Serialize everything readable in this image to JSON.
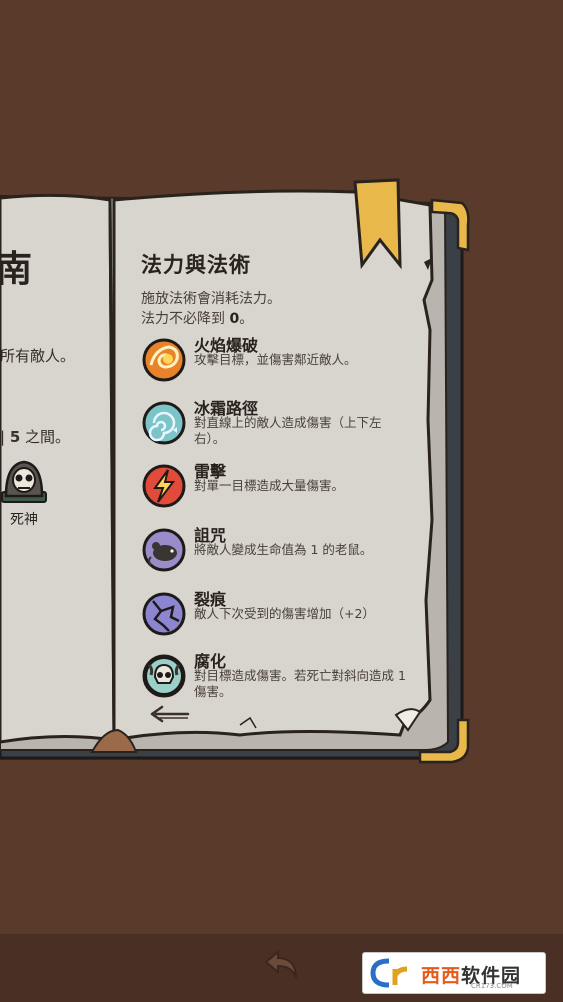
{
  "left_page": {
    "title_fragment": "南",
    "line1": "所有敵人。",
    "line2_prefix": "| ",
    "line2_number": "5",
    "line2_suffix": " 之間。",
    "enemy_label": "死神"
  },
  "right_page": {
    "title": "法力與法術",
    "intro_line1": "施放法術會消耗法力。",
    "intro_line2_prefix": "法力不必降到 ",
    "intro_line2_value": "0",
    "intro_line2_suffix": "。",
    "spells": [
      {
        "name": "火焰爆破",
        "desc": "攻擊目標，並傷害鄰近敵人。",
        "icon": "fireball-icon",
        "color": "#e8832a"
      },
      {
        "name": "冰霜路徑",
        "desc": "對直線上的敵人造成傷害（上下左右）。",
        "icon": "frost-path-icon",
        "color": "#7bc4c8"
      },
      {
        "name": "雷擊",
        "desc": "對單一目標造成大量傷害。",
        "icon": "lightning-icon",
        "color": "#e24a3a"
      },
      {
        "name": "詛咒",
        "desc": "將敵人變成生命值為 1 的老鼠。",
        "icon": "rat-curse-icon",
        "color": "#9a8cc8"
      },
      {
        "name": "裂痕",
        "desc": "敵人下次受到的傷害增加（+2）",
        "icon": "crack-icon",
        "color": "#8c86d0"
      },
      {
        "name": "腐化",
        "desc": "對目標造成傷害。若死亡對斜向造成 1 傷害。",
        "icon": "corruption-skull-icon",
        "color": "#9ad0c8"
      }
    ]
  },
  "watermark": {
    "logo_text": "软件园",
    "logo_prefix": "西西",
    "domain": "CR173.COM"
  },
  "colors": {
    "background": "#5a3a2a",
    "page": "#d6d2cc",
    "ribbon": "#e8b84a"
  }
}
